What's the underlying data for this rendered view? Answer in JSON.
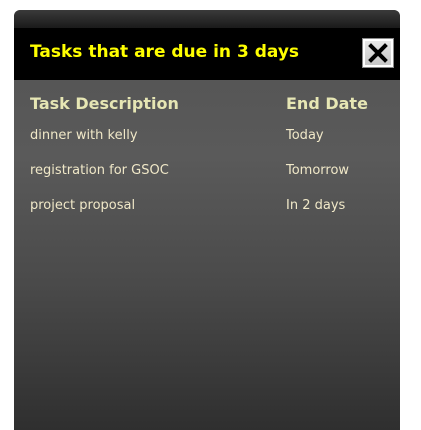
{
  "dialog": {
    "title": "Tasks that are due in 3 days",
    "close_icon": "close-x-icon"
  },
  "table": {
    "headers": {
      "description": "Task Description",
      "end_date": "End Date"
    },
    "rows": [
      {
        "description": "dinner with kelly",
        "end_date": "Today"
      },
      {
        "description": "registration for GSOC",
        "end_date": "Tomorrow"
      },
      {
        "description": "project proposal",
        "end_date": "In 2 days"
      }
    ]
  },
  "colors": {
    "title_text": "#ffff00",
    "header_text": "#e6e6b4",
    "row_text": "#f0e8c8",
    "title_bar": "#000000"
  }
}
